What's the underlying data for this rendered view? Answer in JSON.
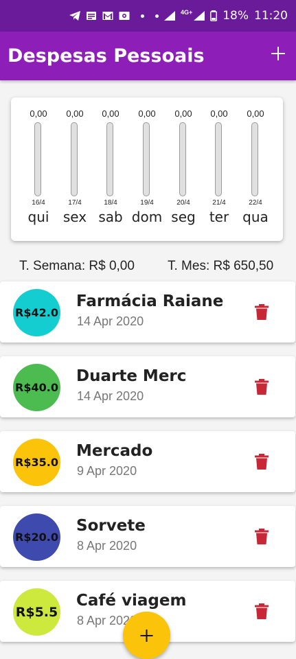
{
  "status_bar": {
    "network_label": "4G+",
    "battery_text": "18%",
    "time": "11:20",
    "icons": [
      "telegram-icon",
      "message-icon",
      "gmail-icon",
      "photo-icon",
      "dot-icon",
      "dot-icon",
      "signal-icon",
      "signal-icon",
      "battery-icon"
    ]
  },
  "app_bar": {
    "title": "Despesas Pessoais",
    "add_icon": "plus-icon"
  },
  "chart_data": {
    "type": "bar",
    "categories": [
      "qui",
      "sex",
      "sab",
      "dom",
      "seg",
      "ter",
      "qua"
    ],
    "dates": [
      "16/4",
      "17/4",
      "18/4",
      "19/4",
      "20/4",
      "21/4",
      "22/4"
    ],
    "values": [
      0,
      0,
      0,
      0,
      0,
      0,
      0
    ],
    "value_labels": [
      "0,00",
      "0,00",
      "0,00",
      "0,00",
      "0,00",
      "0,00",
      "0,00"
    ],
    "fill_fractions": [
      0,
      0,
      0,
      0,
      0,
      0,
      0
    ]
  },
  "totals": {
    "week": "T. Semana: R$ 0,00",
    "month": "T. Mes: R$ 650,50"
  },
  "transactions": [
    {
      "amount": "R$42.0",
      "title": "Farmácia Raiane",
      "date": "14 Apr 2020",
      "color": "#14cdd0"
    },
    {
      "amount": "R$40.0",
      "title": "Duarte Merc",
      "date": "14 Apr 2020",
      "color": "#4cbb50"
    },
    {
      "amount": "R$35.0",
      "title": "Mercado",
      "date": "9 Apr 2020",
      "color": "#fbc40a"
    },
    {
      "amount": "R$20.0",
      "title": "Sorvete",
      "date": "8 Apr 2020",
      "color": "#3f4aae"
    },
    {
      "amount": "R$5.5",
      "title": "Café viagem",
      "date": "8 Apr 2020",
      "color": "#cde93d"
    }
  ],
  "colors": {
    "status_bar": "#6a1b9a",
    "app_bar": "#8e1eb8",
    "delete": "#c62838",
    "fab": "#fbc40a"
  },
  "fab": {
    "icon": "plus-icon"
  }
}
